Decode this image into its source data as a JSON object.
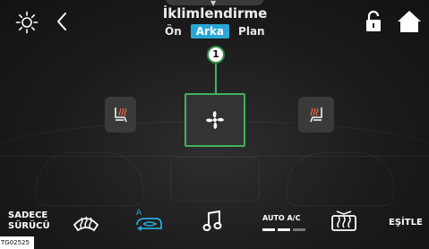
{
  "header": {
    "title": "İklimlendirme",
    "tabs": [
      {
        "label": "Ön",
        "active": false
      },
      {
        "label": "Arka",
        "active": true
      },
      {
        "label": "Plan",
        "active": false
      }
    ]
  },
  "callout": {
    "number": "1"
  },
  "controls": {
    "left_seat": "seat-heat-icon",
    "center": "fan-icon",
    "right_seat": "seat-heat-icon"
  },
  "bottom_bar": {
    "sadece_line1": "SADECE",
    "sadece_line2": "SÜRÜCÜ",
    "auto_ac_label": "AUTO A/C",
    "esitle_label": "EŞİTLE"
  },
  "figure_code": "TG02525",
  "colors": {
    "accent_tab": "#2aa7d6",
    "highlight": "#3fb35a",
    "recirc_icon": "#2aa7d6"
  }
}
